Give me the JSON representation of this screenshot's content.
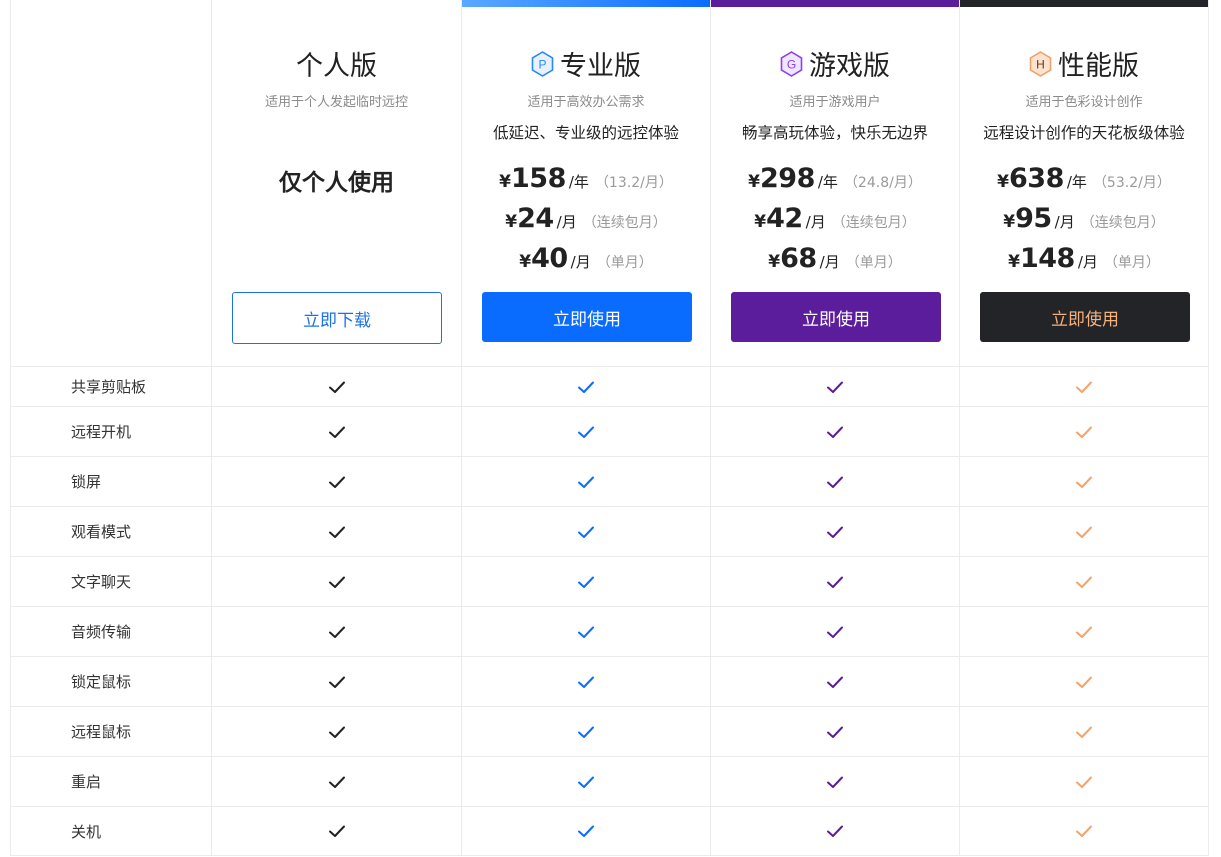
{
  "colors": {
    "personal": "#222222",
    "pro": "#0a6cff",
    "game": "#5b1d9c",
    "perf": "#f5a36b",
    "perf_button_bg": "#222428",
    "perf_button_text": "#f5b27c"
  },
  "plans": [
    {
      "title": "个人版",
      "badge_icon": "",
      "subtitle": "适用于个人发起临时远控",
      "personal_only": "仅个人使用",
      "button": "立即下载"
    },
    {
      "title": "专业版",
      "badge_icon": "P",
      "subtitle": "适用于高效办公需求",
      "tagline": "低延迟、专业级的远控体验",
      "prices": [
        {
          "currency": "¥",
          "amount": "158",
          "unit": "/年",
          "note": "（13.2/月）"
        },
        {
          "currency": "¥",
          "amount": "24",
          "unit": "/月",
          "note": "（连续包月）"
        },
        {
          "currency": "¥",
          "amount": "40",
          "unit": "/月",
          "note": "（单月）"
        }
      ],
      "button": "立即使用"
    },
    {
      "title": "游戏版",
      "badge_icon": "G",
      "subtitle": "适用于游戏用户",
      "tagline": "畅享高玩体验，快乐无边界",
      "prices": [
        {
          "currency": "¥",
          "amount": "298",
          "unit": "/年",
          "note": "（24.8/月）"
        },
        {
          "currency": "¥",
          "amount": "42",
          "unit": "/月",
          "note": "（连续包月）"
        },
        {
          "currency": "¥",
          "amount": "68",
          "unit": "/月",
          "note": "（单月）"
        }
      ],
      "button": "立即使用"
    },
    {
      "title": "性能版",
      "badge_icon": "H",
      "subtitle": "适用于色彩设计创作",
      "tagline": "远程设计创作的天花板级体验",
      "prices": [
        {
          "currency": "¥",
          "amount": "638",
          "unit": "/年",
          "note": "（53.2/月）"
        },
        {
          "currency": "¥",
          "amount": "95",
          "unit": "/月",
          "note": "（连续包月）"
        },
        {
          "currency": "¥",
          "amount": "148",
          "unit": "/月",
          "note": "（单月）"
        }
      ],
      "button": "立即使用"
    }
  ],
  "features": [
    "共享剪贴板",
    "远程开机",
    "锁屏",
    "观看模式",
    "文字聊天",
    "音频传输",
    "锁定鼠标",
    "远程鼠标",
    "重启",
    "关机"
  ],
  "feature_support": "all-plans-check-icon"
}
